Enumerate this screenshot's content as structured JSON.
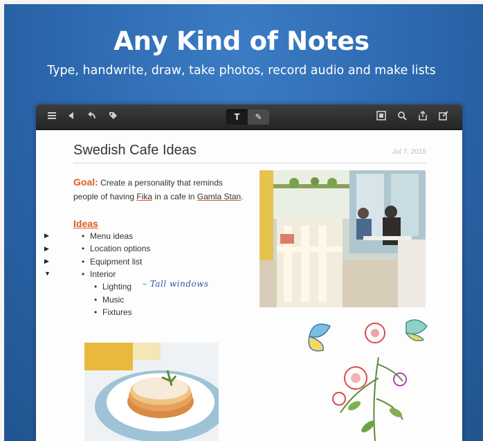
{
  "headline": "Any Kind of Notes",
  "subheadline": "Type, handwrite, draw, take photos, record audio and make lists",
  "toolbar": {
    "left_icons": [
      "list-icon",
      "back-icon",
      "undo-icon",
      "tag-icon"
    ],
    "mode_text": "T",
    "mode_pen": "✎",
    "right_icons": [
      "template-icon",
      "search-icon",
      "share-icon",
      "new-note-icon"
    ]
  },
  "note": {
    "title": "Swedish Cafe Ideas",
    "date": "Jul 7, 2015",
    "goal_label": "Goal:",
    "goal_text_1": "Create a personality that reminds",
    "goal_text_2a": "people of having ",
    "goal_fika": "Fika",
    "goal_text_2b": " in a cafe in ",
    "goal_stan": "Gamla Stan",
    "goal_text_2c": ".",
    "ideas_title": "Ideas",
    "ideas": [
      "Menu ideas",
      "Location options",
      "Equipment list",
      "Interior"
    ],
    "interior_sub": [
      "Lighting",
      "Music",
      "Fixtures"
    ],
    "handwriting": "– Tall windows"
  },
  "colors": {
    "accent": "#e05a1e",
    "background": "#2c67ad",
    "toolbar": "#2e2e2e"
  }
}
